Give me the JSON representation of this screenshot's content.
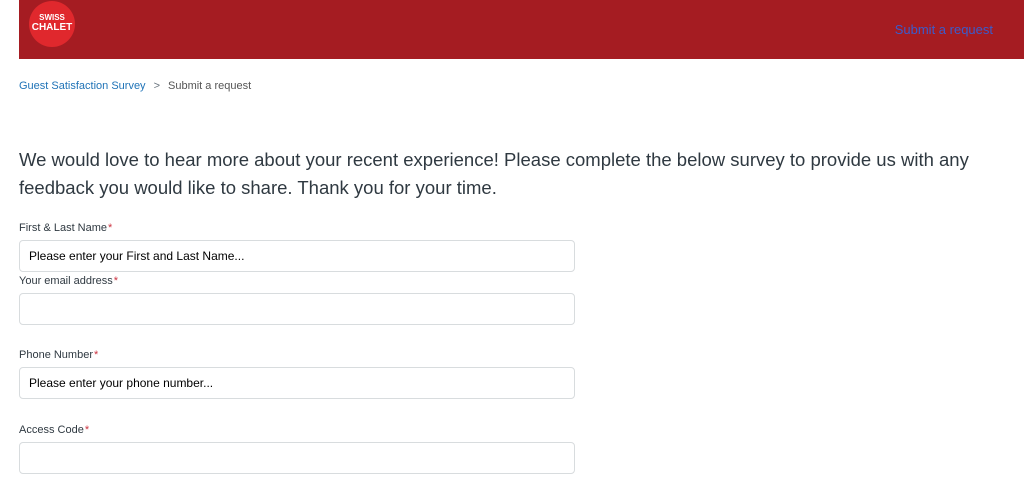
{
  "header": {
    "logo": {
      "line1": "SWISS",
      "line2": "CHALET"
    },
    "submit_request_link": "Submit a request",
    "colors": {
      "background": "#a51c22",
      "logo_circle": "#e0282d",
      "link": "#3a5ccc"
    }
  },
  "breadcrumb": {
    "items": [
      {
        "label": "Guest Satisfaction Survey"
      },
      {
        "label": "Submit a request"
      }
    ],
    "separator": ">"
  },
  "intro_text": "We would love to hear more about your recent experience! Please complete the below survey to provide us with any feedback you would like to share. Thank you for your time.",
  "form": {
    "required_marker": "*",
    "fields": [
      {
        "label": "First & Last Name",
        "value": "Please enter your First and Last Name...",
        "placeholder": ""
      },
      {
        "label": "Your email address",
        "value": "",
        "placeholder": ""
      },
      {
        "label": "Phone Number",
        "value": "Please enter your phone number...",
        "placeholder": ""
      },
      {
        "label": "Access Code",
        "value": "",
        "placeholder": ""
      }
    ]
  }
}
